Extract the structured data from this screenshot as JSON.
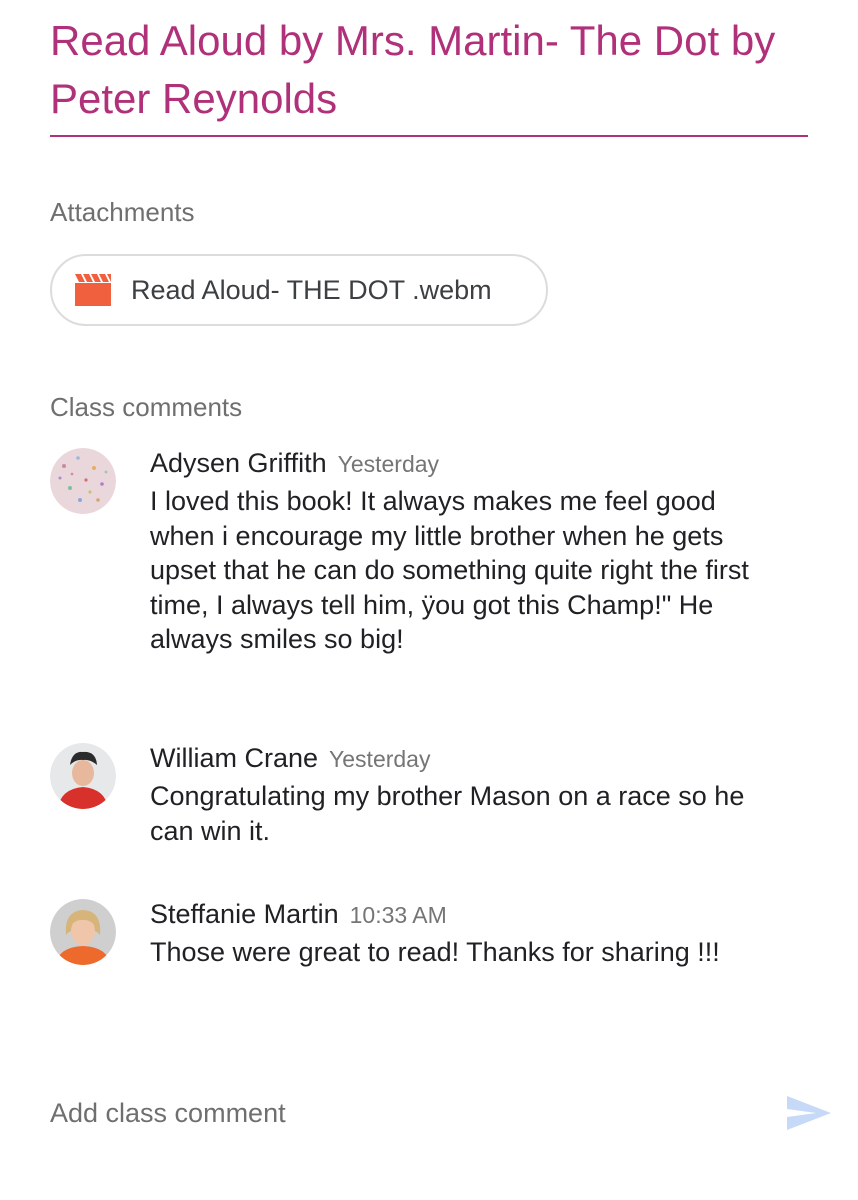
{
  "post": {
    "title": "Read Aloud by Mrs. Martin- The Dot by Peter Reynolds"
  },
  "attachments": {
    "label": "Attachments",
    "items": [
      {
        "name": "Read Aloud- THE DOT .webm",
        "icon": "video-icon"
      }
    ]
  },
  "comments": {
    "label": "Class comments",
    "items": [
      {
        "author": "Adysen Griffith",
        "time": "Yesterday",
        "text": "I loved this book! It always makes me feel good when i encourage my little brother when he gets upset that he can do something quite right the first time, I always tell him, ÿou got this Champ!\" He always smiles so big!"
      },
      {
        "author": "William Crane",
        "time": "Yesterday",
        "text": "Congratulating my brother Mason on a race so he can win it."
      },
      {
        "author": "Steffanie Martin",
        "time": "10:33 AM",
        "text": "Those were great to read! Thanks for sharing !!!"
      }
    ]
  },
  "composer": {
    "placeholder": "Add class comment",
    "send_icon": "send-icon"
  },
  "colors": {
    "title": "#b0317a",
    "video_icon": "#f0603f",
    "send_icon": "#c6daf8",
    "secondary_text": "#6f6f6f"
  }
}
